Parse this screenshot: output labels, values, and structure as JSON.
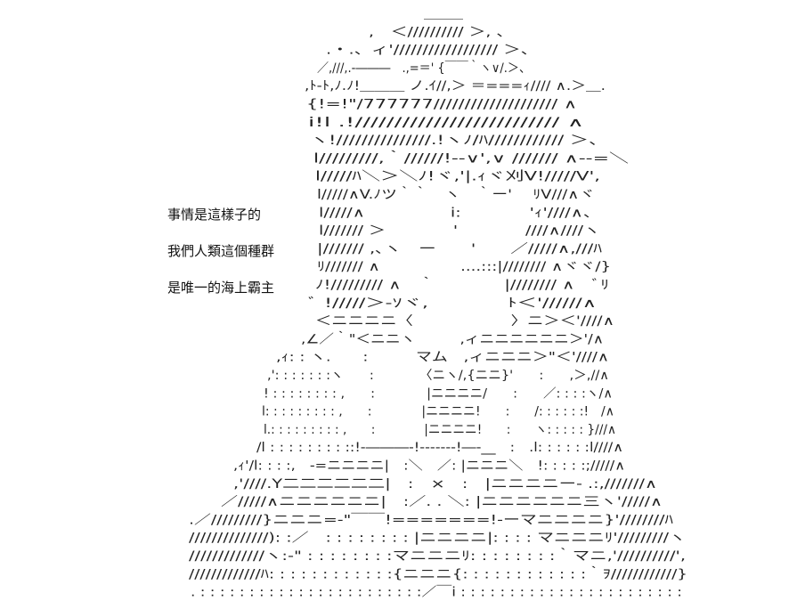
{
  "captions": [
    "事情是這樣子的",
    "我們人類這個種群",
    "是唯一的海上霸主"
  ],
  "ascii_art": [
    "＿＿＿＿",
    ",　＜////////// ＞, 、",
    ".・.、ィ'////////////////// ＞、",
    "／,///,.-―――　.,=＝' {￣￣｀ヽ∨/.＞、",
    ",ﾄ‐ﾄ,ﾉ.ﾉ!＿＿＿ ノ.ｲ//,＞ ＝===ｨ//// ∧.＞＿.",
    "{!=!\"/777777//////////////////// ∧",
    "i!l .!////////////////////////// ∧",
    "ヽ!///////////////.!ヽﾉ/ﾊ//////////// ＞、",
    "l/////////,｀//////!‐-∨',∨ /////// ∧‐-=＼",
    "l/////ﾊ＼＞＼ﾉ!ヾ,'|.ｨヾ刈V!/////V',",
    "l/////∧V.ﾉツ｀｀　ヽ　｀ー'　 ﾘV///∧ヾ",
    "l/////∧　　　　　i:　　　　'ｨ'////∧、",
    "l/////// ＞　　　　'　　　　////∧////ヽ",
    "|/////// ,､ヽ　ー　　'　　／/////∧,///ﾊ",
    "ﾘ/////// ∧　　　　　....:::|//////// ∧ヾヾ/}",
    "ﾉ!///////// ∧　｀　　　　|//////// ∧　ﾞﾘ",
    "ﾞ !/////＞‐ｿヾ,　　　　ﾄ＜'//////∧",
    "＜ニニニニ〈　　　　　　〉ニ＞＜'////∧",
    ",∠／｀\"＜ニニヽ　　　,ィニニニニニニ＞'/∧",
    ",ｨ: : ヽ.　　:　　　マム　,ィニニニ＞\"＜'////∧",
    ",': : : : : : :ヽ　　:　　　　〈ニヽ/,{ニニ}'　　:　　,＞,//∧",
    "! : : : : : : : : ,　　:　　　　|ニニニニ/　　:　　／: : : :ヽ/∧",
    "l: : : : : : : : : ,　　:　　　　|ニニニニ!　　:　　/: : : : : :!　/∧",
    "l.: : : : : : : : : ,　　:　　　　|ニニニニ!　　:　　ヽ: : : : : }///∧",
    "/l : : : : : : : : ::!‐―――‐!‐------!―‐__　:　.l: : : : : :l////∧",
    ",ｨ'/l: : : :,　-=ニニニニ|　:＼　／: |ニニニ＼　!: : : : :;/////∧",
    ",'////.Y二二二二二二|　:　×　:　|ニニニニー‐ .:,///////∧",
    "／/////∧ニニニニニニ|　:／. . ＼: |ニニニニニニ三ヽ'/////∧",
    ".／/////////}ニニニ=‐\"￣￣!=======!‐ーマニニニニ}'////////ﾊ",
    "//////////////): :／　: : : : : : : : |ニニニニ|: : : : マニニニﾘ'/////////ヽ",
    "/////////////ヽ:-\" : : : : : : : :マニニニﾘ: : : : : : : :｀マニ,'//////////',",
    "/////////////ﾊ: : : : : : : : : : : :{ニニニ{: : : : : : : : : : : :｀ｦ////////////}",
    ". : : : : : : : : : : : : : : : : : : : : : : :／￣i : : : : : : : : : : : : : : : : : : : : : : :"
  ]
}
